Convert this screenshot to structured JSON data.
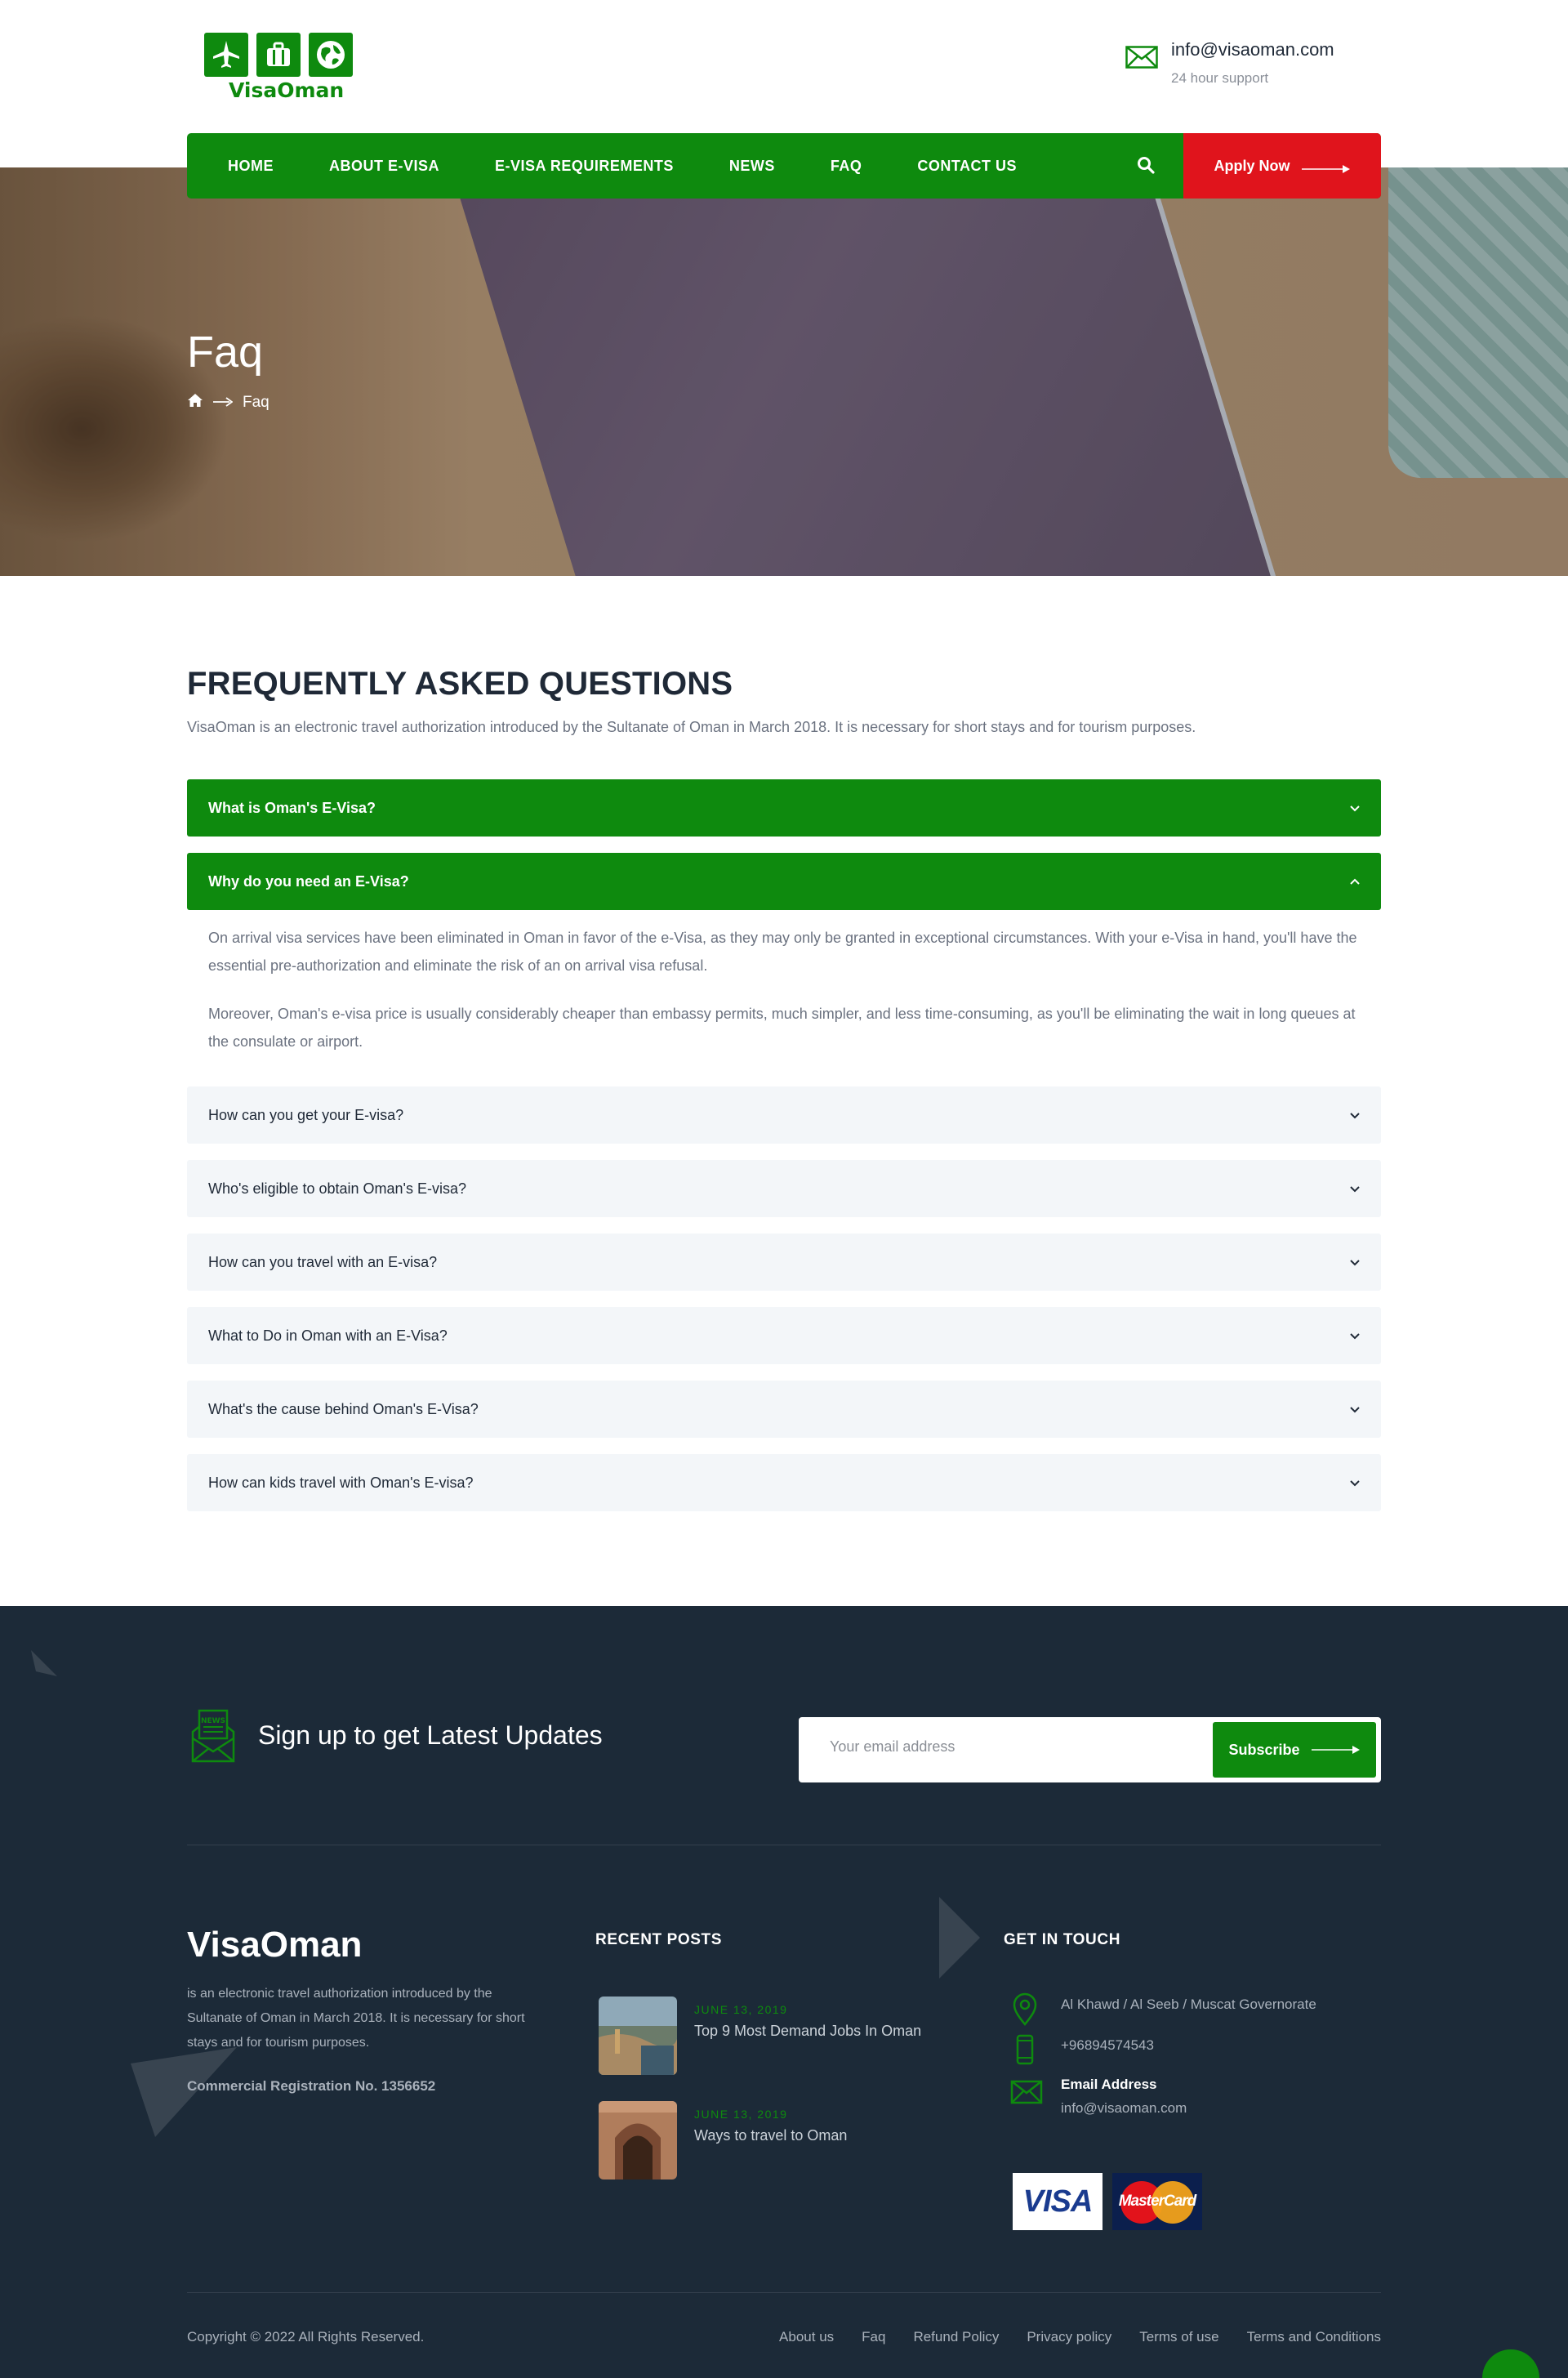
{
  "header": {
    "logo_text": "VisaOman",
    "email": "info@visaoman.com",
    "support": "24 hour support"
  },
  "nav": {
    "items": [
      "HOME",
      "ABOUT E-VISA",
      "E-VISA REQUIREMENTS",
      "NEWS",
      "FAQ",
      "CONTACT US"
    ],
    "apply_label": "Apply Now"
  },
  "hero": {
    "title": "Faq",
    "breadcrumb_current": "Faq"
  },
  "faq": {
    "heading": "FREQUENTLY ASKED QUESTIONS",
    "intro": "VisaOman is an electronic travel authorization introduced by the Sultanate of Oman in March 2018. It is necessary for short stays and for tourism purposes.",
    "items": [
      {
        "question": "What is Oman's E-Visa?"
      },
      {
        "question": "Why do you need an E-Visa?"
      },
      {
        "question": "How can you get your E-visa?"
      },
      {
        "question": "Who's eligible to obtain Oman's E-visa?"
      },
      {
        "question": "How can you travel with an E-visa?"
      },
      {
        "question": "What to Do in Oman with an E-Visa?"
      },
      {
        "question": "What's the cause behind Oman's E-Visa?"
      },
      {
        "question": "How can kids travel with Oman's E-visa?"
      }
    ],
    "answer_paragraphs": [
      "On arrival visa services have been eliminated in Oman in favor of the e-Visa, as they may only be granted in exceptional circumstances. With your e-Visa in hand, you'll have the essential pre-authorization and eliminate the risk of an on arrival visa refusal.",
      "Moreover, Oman's e-visa price is usually considerably cheaper than embassy permits, much simpler, and less time-consuming, as you'll be eliminating the wait in long queues at the consulate or airport."
    ]
  },
  "newsletter": {
    "title": "Sign up to get Latest Updates",
    "placeholder": "Your email address",
    "button": "Subscribe",
    "icon_label": "NEWS"
  },
  "footer": {
    "brand": "VisaOman",
    "description": "is an electronic travel authorization introduced by the Sultanate of Oman in March 2018. It is necessary for short stays and for tourism purposes.",
    "registration": "Commercial Registration No. 1356652",
    "recent_posts_title": "RECENT POSTS",
    "posts": [
      {
        "date": "JUNE 13, 2019",
        "title": "Top 9 Most Demand Jobs In Oman"
      },
      {
        "date": "JUNE 13, 2019",
        "title": "Ways to travel to Oman"
      }
    ],
    "get_in_touch_title": "GET IN TOUCH",
    "address": "Al Khawd / Al Seeb / Muscat Governorate",
    "phone": "+96894574543",
    "email_label": "Email Address",
    "email": "info@visaoman.com",
    "cards": [
      "VISA",
      "MasterCard"
    ],
    "copyright": "Copyright © 2022 All Rights Reserved.",
    "links": [
      "About us",
      "Faq",
      "Refund Policy",
      "Privacy policy",
      "Terms of use",
      "Terms and Conditions"
    ]
  },
  "colors": {
    "brand_green": "#0e8a0e",
    "apply_red": "#e0141c",
    "footer_bg": "#1c2a38",
    "faq_closed_bg": "#f3f6f9"
  }
}
